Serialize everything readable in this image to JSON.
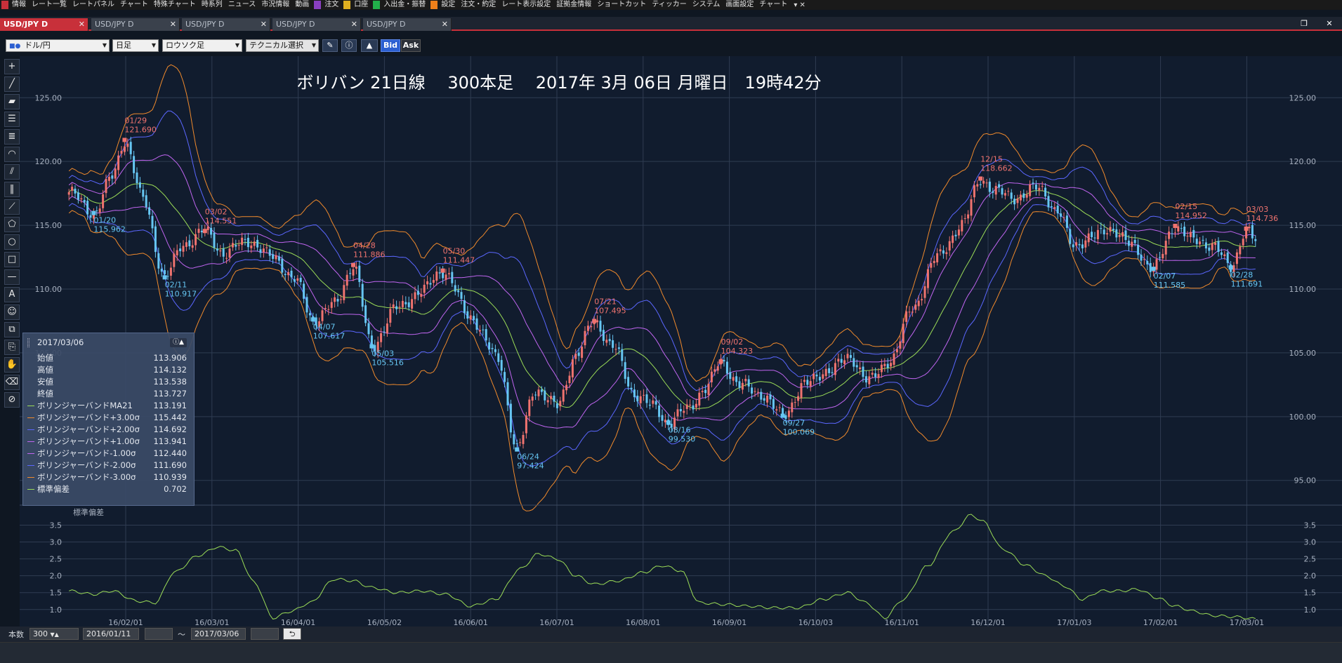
{
  "menubar": {
    "items": [
      {
        "label": "情報",
        "color": "#c8303a"
      },
      {
        "label": "レート一覧",
        "color": ""
      },
      {
        "label": "レートパネル",
        "color": ""
      },
      {
        "label": "チャート",
        "color": ""
      },
      {
        "label": "特殊チャート",
        "color": ""
      },
      {
        "label": "時系列",
        "color": ""
      },
      {
        "label": "ニュース",
        "color": ""
      },
      {
        "label": "市況情報",
        "color": ""
      },
      {
        "label": "動画",
        "color": ""
      },
      {
        "label": "注文",
        "color": "#8a3fc0"
      },
      {
        "label": "口座",
        "color": "#e0b020"
      },
      {
        "label": "入出金・振替",
        "color": "#22b04a"
      },
      {
        "label": "設定",
        "color": "#f0801a"
      },
      {
        "label": "注文・約定",
        "color": ""
      },
      {
        "label": "レート表示設定",
        "color": ""
      },
      {
        "label": "証拠金情報",
        "color": ""
      },
      {
        "label": "ショートカット",
        "color": ""
      },
      {
        "label": "ティッカー",
        "color": ""
      },
      {
        "label": "システム",
        "color": ""
      },
      {
        "label": "画面設定",
        "color": ""
      },
      {
        "label": "チャート",
        "color": ""
      }
    ]
  },
  "tabs": [
    {
      "label": "USD/JPY D",
      "active": true
    },
    {
      "label": "USD/JPY D",
      "active": false
    },
    {
      "label": "USD/JPY D",
      "active": false
    },
    {
      "label": "USD/JPY D",
      "active": false
    },
    {
      "label": "USD/JPY D",
      "active": false
    }
  ],
  "toolbar": {
    "pair": "ドル/円",
    "period": "日足",
    "chart_type": "ロウソク足",
    "technical": "テクニカル選択",
    "bid": "Bid",
    "ask": "Ask"
  },
  "chart_title": "ボリバン 21日線　 300本足　 2017年 3月 06日 月曜日　19時42分",
  "info_panel": {
    "date": "2017/03/06",
    "rows": [
      {
        "label": "始値",
        "value": "113.906",
        "color": ""
      },
      {
        "label": "高値",
        "value": "114.132",
        "color": ""
      },
      {
        "label": "安値",
        "value": "113.538",
        "color": ""
      },
      {
        "label": "終値",
        "value": "113.727",
        "color": ""
      },
      {
        "label": "ボリンジャーバンドMA21",
        "value": "113.191",
        "color": "#9bdc57"
      },
      {
        "label": "ボリンジャーバンド+3.00σ",
        "value": "115.442",
        "color": "#f08a2c"
      },
      {
        "label": "ボリンジャーバンド+2.00σ",
        "value": "114.692",
        "color": "#5b67ff"
      },
      {
        "label": "ボリンジャーバンド+1.00σ",
        "value": "113.941",
        "color": "#c065f0"
      },
      {
        "label": "ボリンジャーバンド-1.00σ",
        "value": "112.440",
        "color": "#c065f0"
      },
      {
        "label": "ボリンジャーバンド-2.00σ",
        "value": "111.690",
        "color": "#5b67ff"
      },
      {
        "label": "ボリンジャーバンド-3.00σ",
        "value": "110.939",
        "color": "#f08a2c"
      },
      {
        "label": "標準偏差",
        "value": "0.702",
        "color": "#9bdc57"
      }
    ]
  },
  "bottom": {
    "count_label": "本数",
    "count": "300",
    "from": "2016/01/11",
    "tilde": "～",
    "to": "2017/03/06"
  },
  "chart_data": {
    "type": "candlestick",
    "y_ticks": [
      "125.00",
      "120.00",
      "115.00",
      "110.00",
      "105.00",
      "100.00",
      "95.00"
    ],
    "x_ticks": [
      "16/02/01",
      "16/03/01",
      "16/04/01",
      "16/05/02",
      "16/06/01",
      "16/07/01",
      "16/08/01",
      "16/09/01",
      "16/10/03",
      "16/11/01",
      "16/12/01",
      "17/01/03",
      "17/02/01",
      "17/03/01"
    ],
    "ylim": [
      93.5,
      126.5
    ],
    "anchors": [
      [
        0,
        117.6
      ],
      [
        8,
        115.96
      ],
      [
        14,
        118.8
      ],
      [
        18,
        121.69
      ],
      [
        24,
        117.0
      ],
      [
        31,
        110.92
      ],
      [
        37,
        113.5
      ],
      [
        44,
        114.55
      ],
      [
        50,
        112.8
      ],
      [
        58,
        113.8
      ],
      [
        66,
        112.5
      ],
      [
        73,
        110.8
      ],
      [
        79,
        107.6
      ],
      [
        86,
        108.8
      ],
      [
        92,
        111.88
      ],
      [
        98,
        105.52
      ],
      [
        106,
        108.5
      ],
      [
        114,
        109.8
      ],
      [
        121,
        111.45
      ],
      [
        130,
        107.8
      ],
      [
        139,
        104.5
      ],
      [
        145,
        97.42
      ],
      [
        151,
        102.2
      ],
      [
        158,
        100.8
      ],
      [
        164,
        104.8
      ],
      [
        170,
        107.5
      ],
      [
        176,
        105.5
      ],
      [
        183,
        101.8
      ],
      [
        189,
        100.8
      ],
      [
        194,
        99.53
      ],
      [
        200,
        100.6
      ],
      [
        206,
        102.2
      ],
      [
        211,
        104.32
      ],
      [
        217,
        102.5
      ],
      [
        224,
        101.8
      ],
      [
        231,
        100.07
      ],
      [
        238,
        102.5
      ],
      [
        246,
        103.7
      ],
      [
        253,
        104.6
      ],
      [
        259,
        102.8
      ],
      [
        266,
        104.5
      ],
      [
        273,
        108.5
      ],
      [
        281,
        112.5
      ],
      [
        289,
        115.0
      ],
      [
        295,
        118.66
      ],
      [
        300,
        117.6
      ],
      [
        307,
        117.2
      ],
      [
        314,
        118.0
      ],
      [
        320,
        116.0
      ],
      [
        325,
        113.5
      ],
      [
        331,
        114.0
      ],
      [
        337,
        114.8
      ],
      [
        344,
        113.4
      ],
      [
        351,
        111.59
      ],
      [
        358,
        114.95
      ],
      [
        364,
        113.8
      ],
      [
        370,
        113.5
      ],
      [
        376,
        111.69
      ],
      [
        381,
        114.74
      ],
      [
        384,
        113.73
      ]
    ],
    "peak_labels": [
      {
        "i": 18,
        "date": "01/29",
        "price": "121.690",
        "type": "high"
      },
      {
        "i": 8,
        "date": "01/20",
        "price": "115.962",
        "type": "low"
      },
      {
        "i": 31,
        "date": "02/11",
        "price": "110.917",
        "type": "low"
      },
      {
        "i": 44,
        "date": "03/02",
        "price": "114.551",
        "type": "high"
      },
      {
        "i": 79,
        "date": "04/07",
        "price": "107.617",
        "type": "low"
      },
      {
        "i": 92,
        "date": "04/28",
        "price": "111.886",
        "type": "high"
      },
      {
        "i": 98,
        "date": "05/03",
        "price": "105.516",
        "type": "low"
      },
      {
        "i": 121,
        "date": "05/30",
        "price": "111.447",
        "type": "high"
      },
      {
        "i": 145,
        "date": "06/24",
        "price": "97.424",
        "type": "low"
      },
      {
        "i": 170,
        "date": "07/21",
        "price": "107.495",
        "type": "high"
      },
      {
        "i": 194,
        "date": "08/16",
        "price": "99.530",
        "type": "low"
      },
      {
        "i": 211,
        "date": "09/02",
        "price": "104.323",
        "type": "high"
      },
      {
        "i": 231,
        "date": "09/27",
        "price": "100.069",
        "type": "low"
      },
      {
        "i": 295,
        "date": "12/15",
        "price": "118.662",
        "type": "high"
      },
      {
        "i": 351,
        "date": "02/07",
        "price": "111.585",
        "type": "low"
      },
      {
        "i": 358,
        "date": "02/15",
        "price": "114.952",
        "type": "high"
      },
      {
        "i": 376,
        "date": "02/28",
        "price": "111.691",
        "type": "low"
      },
      {
        "i": 381,
        "date": "03/03",
        "price": "114.736",
        "type": "high"
      }
    ],
    "sd_panel": {
      "label": "標準偏差",
      "y_ticks": [
        "3.5",
        "3.0",
        "2.5",
        "2.0",
        "1.5",
        "1.0"
      ],
      "ylim": [
        0.6,
        3.8
      ],
      "anchors": [
        [
          0,
          1.55
        ],
        [
          8,
          1.45
        ],
        [
          14,
          1.55
        ],
        [
          22,
          1.25
        ],
        [
          28,
          1.2
        ],
        [
          34,
          2.1
        ],
        [
          42,
          2.6
        ],
        [
          48,
          2.85
        ],
        [
          54,
          2.75
        ],
        [
          60,
          1.8
        ],
        [
          66,
          0.75
        ],
        [
          72,
          0.95
        ],
        [
          78,
          1.2
        ],
        [
          86,
          1.9
        ],
        [
          92,
          1.85
        ],
        [
          98,
          1.65
        ],
        [
          106,
          1.5
        ],
        [
          114,
          1.55
        ],
        [
          122,
          1.45
        ],
        [
          130,
          1.1
        ],
        [
          138,
          1.3
        ],
        [
          146,
          2.2
        ],
        [
          152,
          2.65
        ],
        [
          158,
          2.5
        ],
        [
          164,
          2.0
        ],
        [
          170,
          1.75
        ],
        [
          178,
          1.85
        ],
        [
          186,
          2.1
        ],
        [
          192,
          2.3
        ],
        [
          198,
          2.15
        ],
        [
          204,
          1.2
        ],
        [
          212,
          1.15
        ],
        [
          220,
          1.1
        ],
        [
          228,
          1.05
        ],
        [
          236,
          1.05
        ],
        [
          244,
          1.3
        ],
        [
          252,
          1.5
        ],
        [
          258,
          1.2
        ],
        [
          264,
          0.75
        ],
        [
          270,
          1.3
        ],
        [
          278,
          2.3
        ],
        [
          286,
          3.3
        ],
        [
          292,
          3.8
        ],
        [
          296,
          3.6
        ],
        [
          302,
          2.8
        ],
        [
          310,
          2.3
        ],
        [
          316,
          2.0
        ],
        [
          322,
          1.7
        ],
        [
          328,
          1.3
        ],
        [
          334,
          1.55
        ],
        [
          340,
          1.55
        ],
        [
          346,
          1.6
        ],
        [
          352,
          1.35
        ],
        [
          358,
          1.1
        ],
        [
          364,
          0.95
        ],
        [
          370,
          0.82
        ],
        [
          378,
          0.78
        ],
        [
          384,
          0.72
        ]
      ]
    },
    "colors": {
      "up": "#f0736f",
      "down": "#66c6f2",
      "ma": "#9bdc57",
      "s1": "#c065f0",
      "s2": "#5b67ff",
      "s3": "#f08a2c",
      "grid": "#2f3c52"
    }
  }
}
